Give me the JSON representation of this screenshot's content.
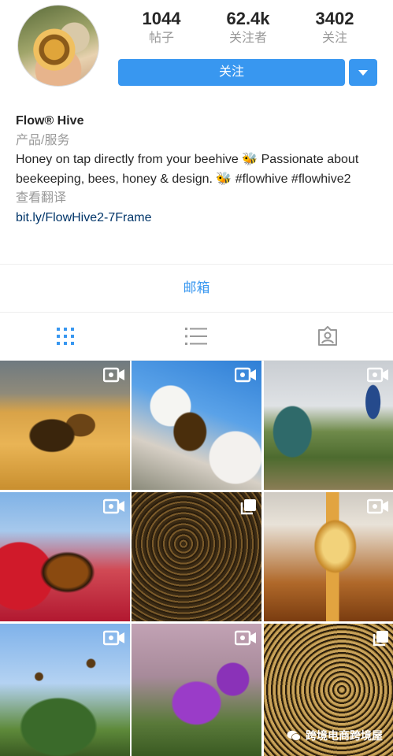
{
  "profile": {
    "name": "Flow® Hive",
    "category": "产品/服务",
    "bio": "Honey on tap directly from your beehive 🐝 Passionate about beekeeping, bees, honey & design. 🐝 #flowhive #flowhive2",
    "translate": "查看翻译",
    "link": "bit.ly/FlowHive2-7Frame"
  },
  "stats": {
    "posts_value": "1044",
    "posts_label": "帖子",
    "followers_value": "62.4k",
    "followers_label": "关注者",
    "following_value": "3402",
    "following_label": "关注"
  },
  "actions": {
    "follow_label": "关注",
    "email_label": "邮箱"
  },
  "tabs": [
    {
      "icon": "grid-icon",
      "active": true
    },
    {
      "icon": "list-icon",
      "active": false
    },
    {
      "icon": "tagged-icon",
      "active": false
    }
  ],
  "grid": [
    {
      "type": "video",
      "icon": "video-camera-icon"
    },
    {
      "type": "video",
      "icon": "video-camera-icon"
    },
    {
      "type": "video",
      "icon": "video-camera-icon"
    },
    {
      "type": "video",
      "icon": "video-camera-icon"
    },
    {
      "type": "carousel",
      "icon": "multiple-posts-icon"
    },
    {
      "type": "video",
      "icon": "video-camera-icon"
    },
    {
      "type": "video",
      "icon": "video-camera-icon"
    },
    {
      "type": "video",
      "icon": "video-camera-icon"
    },
    {
      "type": "carousel",
      "icon": "multiple-posts-icon"
    }
  ],
  "watermark": "跨境电商跨境屋",
  "colors": {
    "accent": "#3897f0",
    "link": "#003569",
    "muted": "#999999",
    "text": "#262626"
  }
}
